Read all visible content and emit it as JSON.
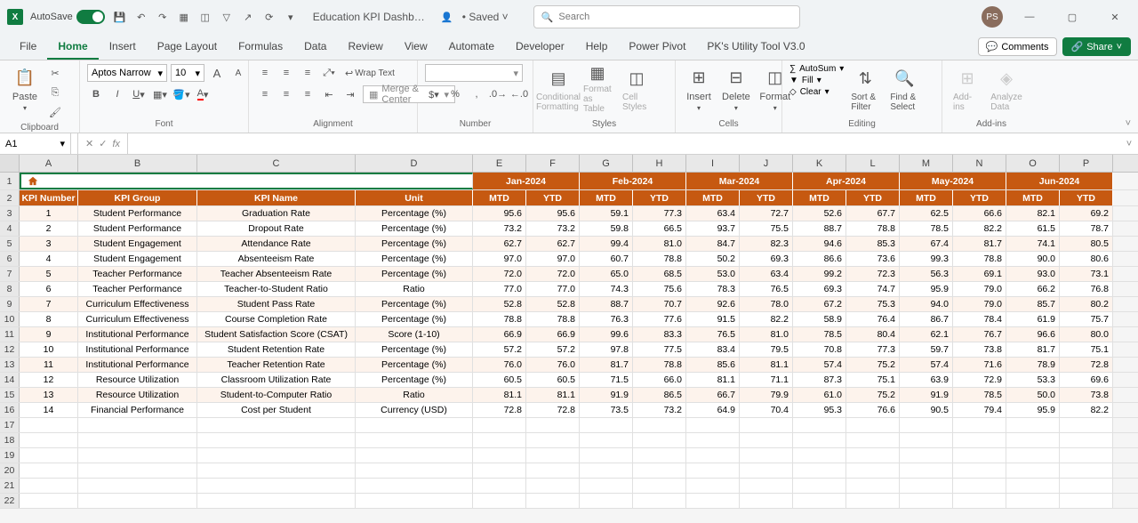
{
  "titlebar": {
    "autosave": "AutoSave",
    "doc_title": "Education KPI Dashb…",
    "saved": "• Saved",
    "search_placeholder": "Search",
    "avatar": "PS"
  },
  "tabs": [
    "File",
    "Home",
    "Insert",
    "Page Layout",
    "Formulas",
    "Data",
    "Review",
    "View",
    "Automate",
    "Developer",
    "Help",
    "Power Pivot",
    "PK's Utility Tool V3.0"
  ],
  "active_tab": "Home",
  "comments_btn": "Comments",
  "share_btn": "Share",
  "ribbon": {
    "paste": "Paste",
    "wrap_text": "Wrap Text",
    "merge_center": "Merge & Center",
    "cond_fmt": "Conditional Formatting",
    "fmt_table": "Format as Table",
    "cell_styles": "Cell Styles",
    "insert": "Insert",
    "delete": "Delete",
    "format": "Format",
    "autosum": "AutoSum",
    "fill": "Fill",
    "clear": "Clear",
    "sort_filter": "Sort & Filter",
    "find_select": "Find & Select",
    "addins": "Add-ins",
    "analyze": "Analyze Data",
    "font_name": "Aptos Narrow",
    "font_size": "10",
    "groups": {
      "clipboard": "Clipboard",
      "font": "Font",
      "alignment": "Alignment",
      "number": "Number",
      "styles": "Styles",
      "cells": "Cells",
      "editing": "Editing",
      "addins": "Add-ins"
    }
  },
  "name_box": "A1",
  "columns": [
    "A",
    "B",
    "C",
    "D",
    "E",
    "F",
    "G",
    "H",
    "I",
    "J",
    "K",
    "L",
    "M",
    "N",
    "O",
    "P"
  ],
  "months": [
    "Jan-2024",
    "Feb-2024",
    "Mar-2024",
    "Apr-2024",
    "May-2024",
    "Jun-2024"
  ],
  "headers": {
    "kpi_num": "KPI Number",
    "kpi_group": "KPI Group",
    "kpi_name": "KPI Name",
    "unit": "Unit",
    "mtd": "MTD",
    "ytd": "YTD"
  },
  "rows": [
    {
      "n": "1",
      "g": "Student Performance",
      "name": "Graduation Rate",
      "u": "Percentage (%)",
      "v": [
        "95.6",
        "95.6",
        "59.1",
        "77.3",
        "63.4",
        "72.7",
        "52.6",
        "67.7",
        "62.5",
        "66.6",
        "82.1",
        "69.2"
      ]
    },
    {
      "n": "2",
      "g": "Student Performance",
      "name": "Dropout Rate",
      "u": "Percentage (%)",
      "v": [
        "73.2",
        "73.2",
        "59.8",
        "66.5",
        "93.7",
        "75.5",
        "88.7",
        "78.8",
        "78.5",
        "82.2",
        "61.5",
        "78.7"
      ]
    },
    {
      "n": "3",
      "g": "Student Engagement",
      "name": "Attendance Rate",
      "u": "Percentage (%)",
      "v": [
        "62.7",
        "62.7",
        "99.4",
        "81.0",
        "84.7",
        "82.3",
        "94.6",
        "85.3",
        "67.4",
        "81.7",
        "74.1",
        "80.5"
      ]
    },
    {
      "n": "4",
      "g": "Student Engagement",
      "name": "Absenteeism Rate",
      "u": "Percentage (%)",
      "v": [
        "97.0",
        "97.0",
        "60.7",
        "78.8",
        "50.2",
        "69.3",
        "86.6",
        "73.6",
        "99.3",
        "78.8",
        "90.0",
        "80.6"
      ]
    },
    {
      "n": "5",
      "g": "Teacher Performance",
      "name": "Teacher Absenteeism Rate",
      "u": "Percentage (%)",
      "v": [
        "72.0",
        "72.0",
        "65.0",
        "68.5",
        "53.0",
        "63.4",
        "99.2",
        "72.3",
        "56.3",
        "69.1",
        "93.0",
        "73.1"
      ]
    },
    {
      "n": "6",
      "g": "Teacher Performance",
      "name": "Teacher-to-Student Ratio",
      "u": "Ratio",
      "v": [
        "77.0",
        "77.0",
        "74.3",
        "75.6",
        "78.3",
        "76.5",
        "69.3",
        "74.7",
        "95.9",
        "79.0",
        "66.2",
        "76.8"
      ]
    },
    {
      "n": "7",
      "g": "Curriculum Effectiveness",
      "name": "Student Pass Rate",
      "u": "Percentage (%)",
      "v": [
        "52.8",
        "52.8",
        "88.7",
        "70.7",
        "92.6",
        "78.0",
        "67.2",
        "75.3",
        "94.0",
        "79.0",
        "85.7",
        "80.2"
      ]
    },
    {
      "n": "8",
      "g": "Curriculum Effectiveness",
      "name": "Course Completion Rate",
      "u": "Percentage (%)",
      "v": [
        "78.8",
        "78.8",
        "76.3",
        "77.6",
        "91.5",
        "82.2",
        "58.9",
        "76.4",
        "86.7",
        "78.4",
        "61.9",
        "75.7"
      ]
    },
    {
      "n": "9",
      "g": "Institutional Performance",
      "name": "Student Satisfaction Score (CSAT)",
      "u": "Score (1-10)",
      "v": [
        "66.9",
        "66.9",
        "99.6",
        "83.3",
        "76.5",
        "81.0",
        "78.5",
        "80.4",
        "62.1",
        "76.7",
        "96.6",
        "80.0"
      ]
    },
    {
      "n": "10",
      "g": "Institutional Performance",
      "name": "Student Retention Rate",
      "u": "Percentage (%)",
      "v": [
        "57.2",
        "57.2",
        "97.8",
        "77.5",
        "83.4",
        "79.5",
        "70.8",
        "77.3",
        "59.7",
        "73.8",
        "81.7",
        "75.1"
      ]
    },
    {
      "n": "11",
      "g": "Institutional Performance",
      "name": "Teacher Retention Rate",
      "u": "Percentage (%)",
      "v": [
        "76.0",
        "76.0",
        "81.7",
        "78.8",
        "85.6",
        "81.1",
        "57.4",
        "75.2",
        "57.4",
        "71.6",
        "78.9",
        "72.8"
      ]
    },
    {
      "n": "12",
      "g": "Resource Utilization",
      "name": "Classroom Utilization Rate",
      "u": "Percentage (%)",
      "v": [
        "60.5",
        "60.5",
        "71.5",
        "66.0",
        "81.1",
        "71.1",
        "87.3",
        "75.1",
        "63.9",
        "72.9",
        "53.3",
        "69.6"
      ]
    },
    {
      "n": "13",
      "g": "Resource Utilization",
      "name": "Student-to-Computer Ratio",
      "u": "Ratio",
      "v": [
        "81.1",
        "81.1",
        "91.9",
        "86.5",
        "66.7",
        "79.9",
        "61.0",
        "75.2",
        "91.9",
        "78.5",
        "50.0",
        "73.8"
      ]
    },
    {
      "n": "14",
      "g": "Financial Performance",
      "name": "Cost per Student",
      "u": "Currency (USD)",
      "v": [
        "72.8",
        "72.8",
        "73.5",
        "73.2",
        "64.9",
        "70.4",
        "95.3",
        "76.6",
        "90.5",
        "79.4",
        "95.9",
        "82.2"
      ]
    }
  ],
  "empty_rows": [
    "17",
    "18",
    "19",
    "20",
    "21",
    "22"
  ]
}
